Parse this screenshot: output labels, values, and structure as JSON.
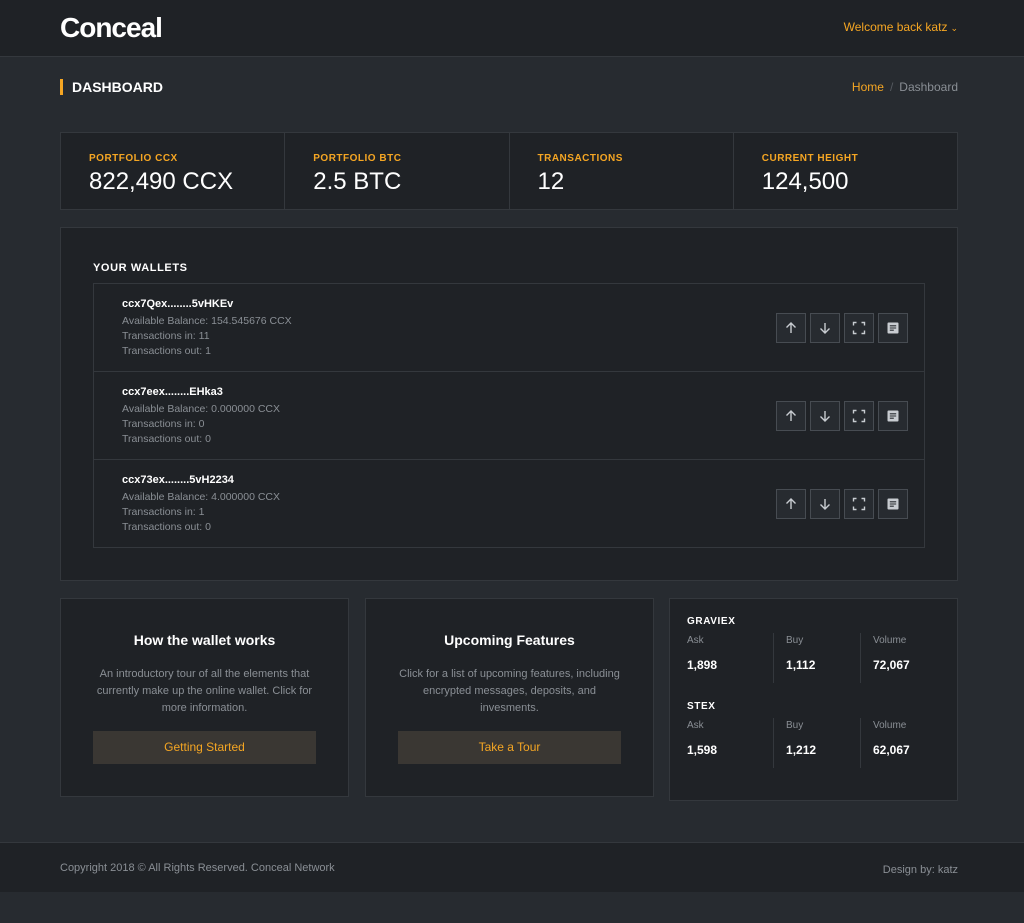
{
  "header": {
    "logo": "Conceal",
    "welcome": "Welcome back katz"
  },
  "page": {
    "title": "DASHBOARD",
    "breadcrumb": {
      "home": "Home",
      "sep": "/",
      "current": "Dashboard"
    }
  },
  "stats": [
    {
      "label": "PORTFOLIO CCX",
      "value": "822,490 CCX"
    },
    {
      "label": "PORTFOLIO BTC",
      "value": "2.5 BTC"
    },
    {
      "label": "TRANSACTIONS",
      "value": "12"
    },
    {
      "label": "CURRENT HEIGHT",
      "value": "124,500"
    }
  ],
  "wallets": {
    "title": "YOUR WALLETS",
    "items": [
      {
        "address": "ccx7Qex........5vHKEv",
        "balance": "Available Balance: 154.545676 CCX",
        "tx_in": "Transactions in: 11",
        "tx_out": "Transactions out: 1"
      },
      {
        "address": "ccx7eex........EHka3",
        "balance": "Available Balance: 0.000000 CCX",
        "tx_in": "Transactions in: 0",
        "tx_out": "Transactions out: 0"
      },
      {
        "address": "ccx73ex........5vH2234",
        "balance": "Available Balance: 4.000000 CCX",
        "tx_in": "Transactions in: 1",
        "tx_out": "Transactions out: 0"
      }
    ],
    "action_icons": [
      "arrow-up-icon",
      "arrow-down-icon",
      "fullscreen-icon",
      "details-icon"
    ]
  },
  "cards": [
    {
      "title": "How the wallet works",
      "text": "An introductory tour of all the elements that currently make up the online wallet. Click for more information.",
      "button": "Getting Started"
    },
    {
      "title": "Upcoming Features",
      "text": "Click for a list of upcoming features, including encrypted messages, deposits, and invesments.",
      "button": "Take a Tour"
    }
  ],
  "exchanges": [
    {
      "name": "GRAVIEX",
      "cols": [
        {
          "label": "Ask",
          "value": "1,898"
        },
        {
          "label": "Buy",
          "value": "1,112"
        },
        {
          "label": "Volume",
          "value": "72,067"
        }
      ]
    },
    {
      "name": "STEX",
      "cols": [
        {
          "label": "Ask",
          "value": "1,598"
        },
        {
          "label": "Buy",
          "value": "1,212"
        },
        {
          "label": "Volume",
          "value": "62,067"
        }
      ]
    }
  ],
  "footer": {
    "copyright": "Copyright 2018 © All Rights Reserved. Conceal Network",
    "design": "Design by: katz"
  },
  "colors": {
    "accent": "#f5a623",
    "background": "#272b30",
    "panel": "#1f2226"
  }
}
